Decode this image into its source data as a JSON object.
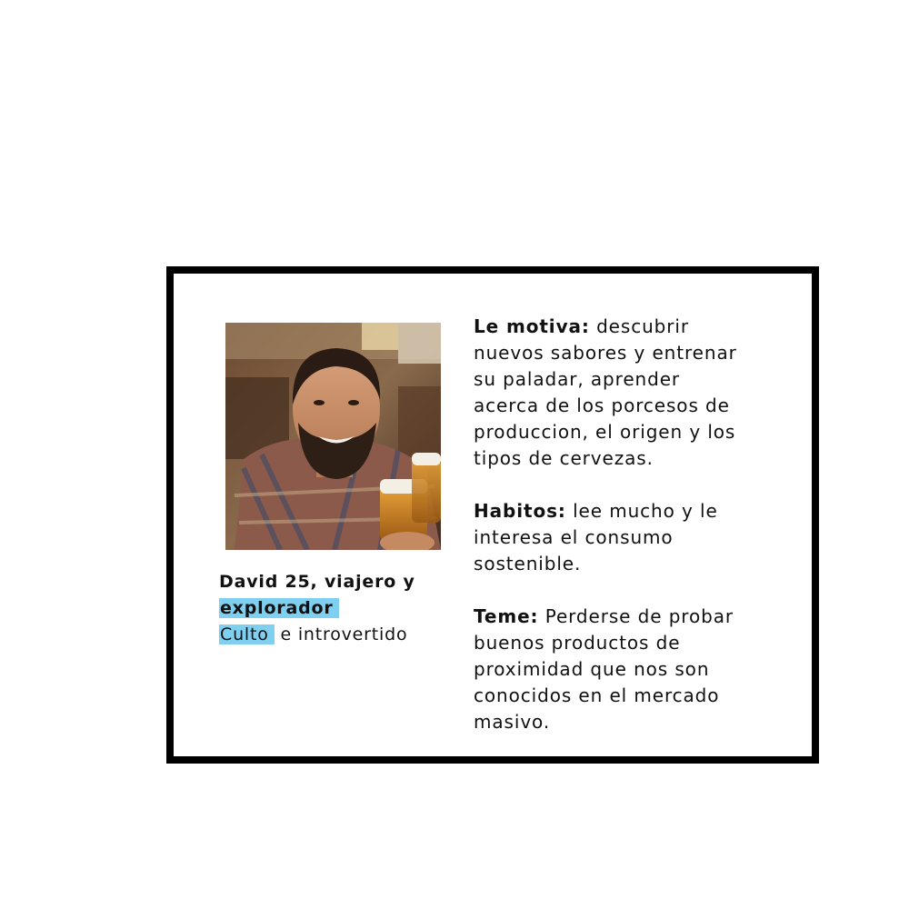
{
  "profile": {
    "name_line": "David 25, viajero y",
    "highlight_1": "explorador",
    "highlight_2": "Culto",
    "after_highlight_2": " e introvertido"
  },
  "sections": [
    {
      "label": "Le motiva:",
      "text": " descubrir\nnuevos sabores y entrenar\nsu paladar, aprender\nacerca de los porcesos de\nproduccion, el origen y los\ntipos de cervezas."
    },
    {
      "label": "Habitos:",
      "text": " lee mucho y le\ninteresa el consumo\nsostenible."
    },
    {
      "label": "Teme:",
      "text": " Perderse de probar\nbuenos productos de\nproximidad que nos son\nconocidos en el mercado\nmasivo."
    }
  ],
  "colors": {
    "border": "#000000",
    "highlight": "#7ecff0"
  }
}
